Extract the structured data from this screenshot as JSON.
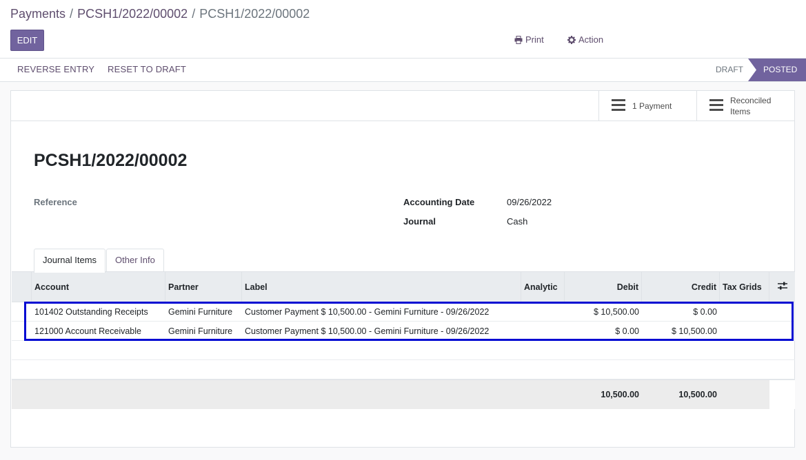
{
  "breadcrumb": {
    "items": [
      "Payments",
      "PCSH1/2022/00002",
      "PCSH1/2022/00002"
    ],
    "separator": "/"
  },
  "toolbar": {
    "edit_label": "EDIT",
    "print_label": "Print",
    "action_label": "Action"
  },
  "statusbar": {
    "reverse_entry": "REVERSE ENTRY",
    "reset_to_draft": "RESET TO DRAFT",
    "stages": [
      "DRAFT",
      "POSTED"
    ],
    "active_stage": "POSTED"
  },
  "smart_buttons": {
    "payment": "1 Payment",
    "reconciled_line1": "Reconciled",
    "reconciled_line2": "Items"
  },
  "record": {
    "title": "PCSH1/2022/00002",
    "reference_label": "Reference",
    "accounting_date_label": "Accounting Date",
    "accounting_date_value": "09/26/2022",
    "journal_label": "Journal",
    "journal_value": "Cash"
  },
  "tabs": [
    "Journal Items",
    "Other Info"
  ],
  "table": {
    "headers": [
      "Account",
      "Partner",
      "Label",
      "Analytic",
      "Debit",
      "Credit",
      "Tax Grids"
    ],
    "rows": [
      {
        "account": "101402 Outstanding Receipts",
        "partner": "Gemini Furniture",
        "label": "Customer Payment $ 10,500.00 - Gemini Furniture - 09/26/2022",
        "analytic": "",
        "debit": "$ 10,500.00",
        "credit": "$ 0.00",
        "tax_grids": ""
      },
      {
        "account": "121000 Account Receivable",
        "partner": "Gemini Furniture",
        "label": "Customer Payment $ 10,500.00 - Gemini Furniture - 09/26/2022",
        "analytic": "",
        "debit": "$ 0.00",
        "credit": "$ 10,500.00",
        "tax_grids": ""
      }
    ],
    "totals": {
      "debit": "10,500.00",
      "credit": "10,500.00"
    }
  },
  "colors": {
    "primary": "#71639e",
    "link": "#5f4e6e",
    "highlight_box": "#0008d2"
  }
}
